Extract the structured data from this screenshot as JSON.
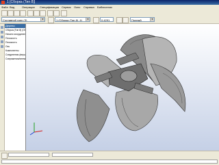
{
  "window": {
    "title": "1 [Сборка (Тип 8)]"
  },
  "menu": {
    "items": [
      "Файл",
      "Вид",
      "Операции",
      "Спецификация",
      "Сервис",
      "Окно",
      "Справка",
      "Библиотеки"
    ]
  },
  "toolbar": {
    "view_combo": "Составной узел (З)",
    "assembly_combo": "1 (Сборка (Тип 8), 4)",
    "zoom_value": "0.4291",
    "display_combo": "Полный"
  },
  "tree": {
    "header": "Дерево",
    "items": [
      "Сборка (Тип 8) (Оборотно",
      "Начало координат",
      "Плоскость",
      "Плоскость",
      "Ось",
      "Компоненты",
      "Соединения (вершина)",
      "Сопряжения/элементы"
    ]
  },
  "colors": {
    "accent": "#0a246a",
    "viewport_top": "#ffffff",
    "viewport_bottom": "#c5d0e6"
  },
  "icons": [
    "app-icon",
    "new-file-icon",
    "open-icon",
    "save-icon",
    "print-icon",
    "cut-icon",
    "copy-icon",
    "paste-icon",
    "undo-icon",
    "redo-icon",
    "zoom-icon",
    "rotate-icon",
    "axis-triad-icon"
  ]
}
